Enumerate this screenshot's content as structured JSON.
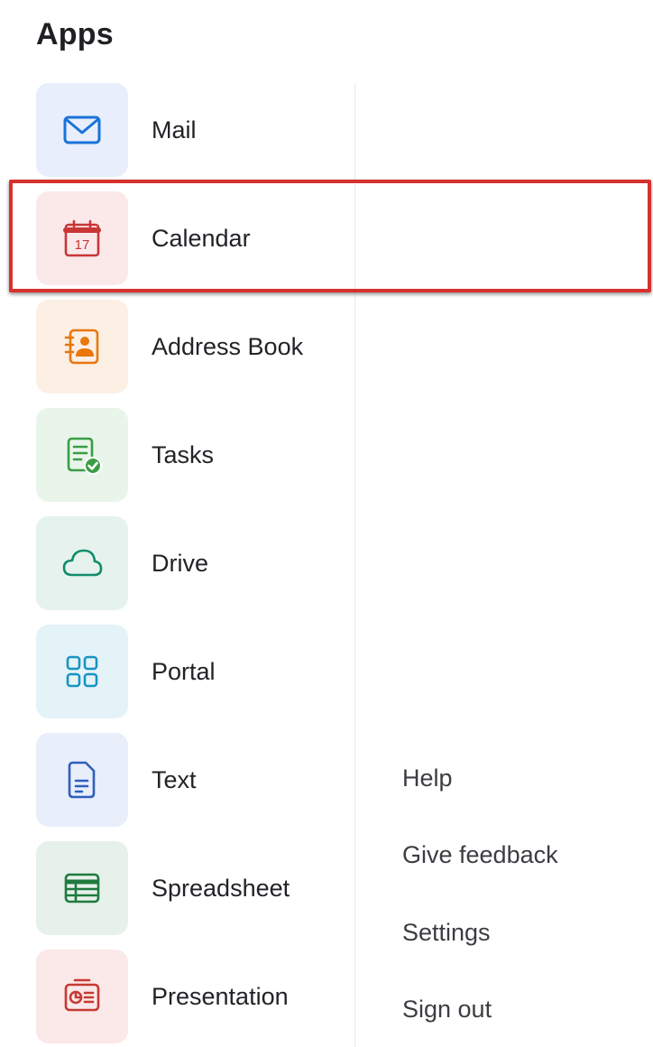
{
  "title": "Apps",
  "apps": [
    {
      "label": "Mail",
      "icon": "mail-icon",
      "tile_bg": "#e8eefb",
      "color": "#1a73d9"
    },
    {
      "label": "Calendar",
      "icon": "calendar-icon",
      "calendar_day": "17",
      "tile_bg": "#fbe9ea",
      "color": "#c93636"
    },
    {
      "label": "Address Book",
      "icon": "address-book-icon",
      "tile_bg": "#fcefe4",
      "color": "#e8780c"
    },
    {
      "label": "Tasks",
      "icon": "tasks-icon",
      "tile_bg": "#e9f5ea",
      "color": "#3a9d46"
    },
    {
      "label": "Drive",
      "icon": "cloud-icon",
      "tile_bg": "#e6f2ee",
      "color": "#0f8d6a"
    },
    {
      "label": "Portal",
      "icon": "grid-icon",
      "tile_bg": "#e4f3f8",
      "color": "#1794c2"
    },
    {
      "label": "Text",
      "icon": "document-icon",
      "tile_bg": "#e8eefa",
      "color": "#2f5fbd"
    },
    {
      "label": "Spreadsheet",
      "icon": "spreadsheet-icon",
      "tile_bg": "#e6f1ea",
      "color": "#1f7a3e"
    },
    {
      "label": "Presentation",
      "icon": "presentation-icon",
      "tile_bg": "#fbe8e8",
      "color": "#c53a32"
    }
  ],
  "links": [
    {
      "label": "Help"
    },
    {
      "label": "Give feedback"
    },
    {
      "label": "Settings"
    },
    {
      "label": "Sign out"
    }
  ],
  "colors": {
    "highlight_border": "#d8312c",
    "divider": "#e9e9ec",
    "text": "#222327"
  }
}
